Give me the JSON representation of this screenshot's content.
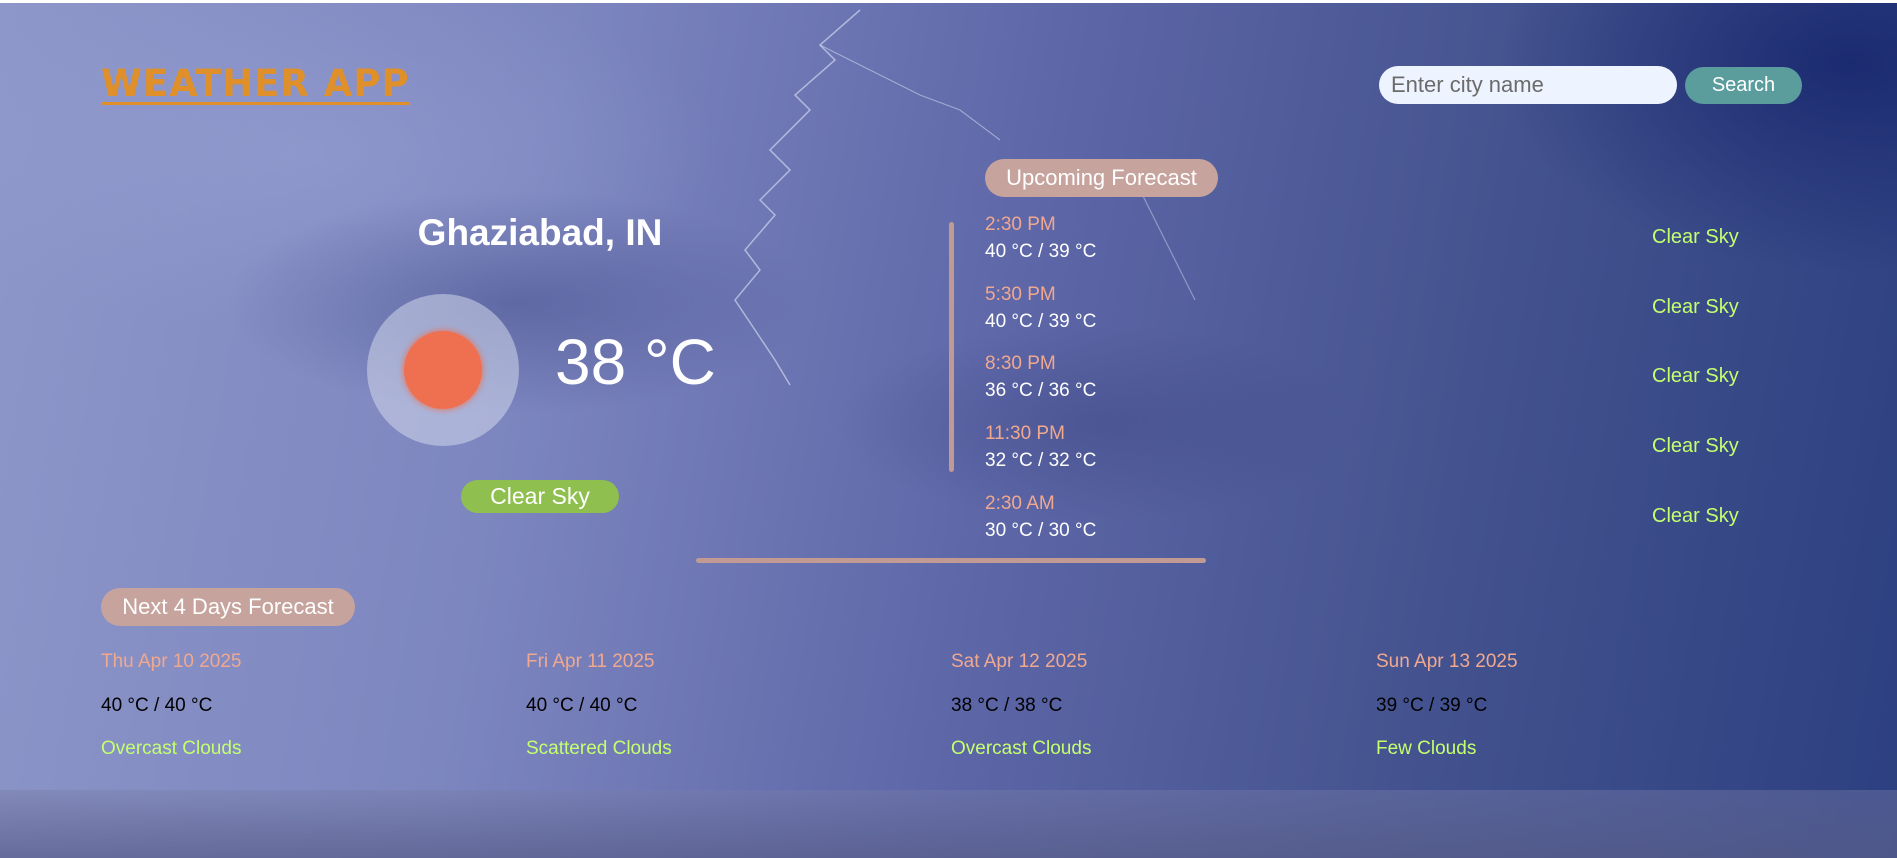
{
  "app": {
    "title": "WEATHER APP"
  },
  "search": {
    "placeholder": "Enter city name",
    "value": "",
    "button_label": "Search"
  },
  "current": {
    "location": "Ghaziabad, IN",
    "temperature": "38 °C",
    "condition": "Clear Sky",
    "icon": "sun-icon"
  },
  "upcoming": {
    "title": "Upcoming Forecast",
    "items": [
      {
        "time": "2:30 PM",
        "temps": "40 °C / 39 °C",
        "desc": "Clear Sky"
      },
      {
        "time": "5:30 PM",
        "temps": "40 °C / 39 °C",
        "desc": "Clear Sky"
      },
      {
        "time": "8:30 PM",
        "temps": "36 °C / 36 °C",
        "desc": "Clear Sky"
      },
      {
        "time": "11:30 PM",
        "temps": "32 °C / 32 °C",
        "desc": "Clear Sky"
      },
      {
        "time": "2:30 AM",
        "temps": "30 °C / 30 °C",
        "desc": "Clear Sky"
      }
    ]
  },
  "days": {
    "title": "Next 4 Days Forecast",
    "items": [
      {
        "date": "Thu Apr 10 2025",
        "temps": "40 °C / 40 °C",
        "desc": "Overcast Clouds"
      },
      {
        "date": "Fri Apr 11 2025",
        "temps": "40 °C / 40 °C",
        "desc": "Scattered Clouds"
      },
      {
        "date": "Sat Apr 12 2025",
        "temps": "38 °C / 38 °C",
        "desc": "Overcast Clouds"
      },
      {
        "date": "Sun Apr 13 2025",
        "temps": "39 °C / 39 °C",
        "desc": "Few Clouds"
      }
    ]
  },
  "colors": {
    "logo": "#e0902a",
    "time_text": "#f0a88f",
    "condition_text": "#c4ff6e",
    "sun": "#ef7050",
    "condition_badge": "#8fbf4e",
    "section_pill": "#c6a39d",
    "search_button": "#5b9c9c"
  }
}
